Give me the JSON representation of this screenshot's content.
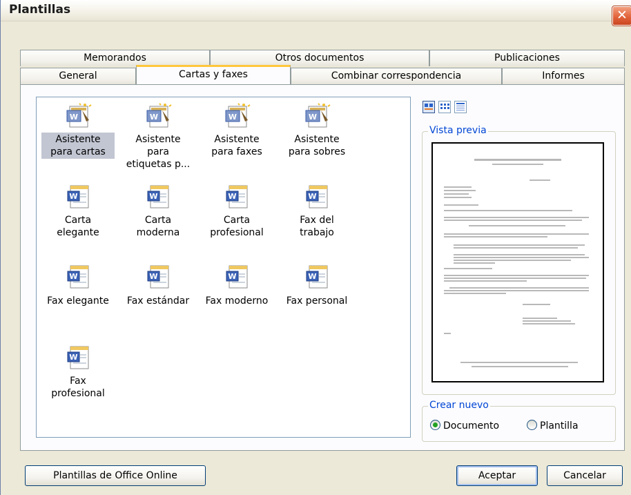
{
  "window": {
    "title": "Plantillas"
  },
  "tabs": {
    "row_back": [
      {
        "label": "Memorandos"
      },
      {
        "label": "Otros documentos"
      },
      {
        "label": "Publicaciones"
      }
    ],
    "row_front": [
      {
        "label": "General"
      },
      {
        "label": "Cartas y faxes",
        "active": true
      },
      {
        "label": "Combinar correspondencia"
      },
      {
        "label": "Informes"
      }
    ]
  },
  "templates": [
    {
      "label": "Asistente para cartas",
      "icon": "wizard-icon",
      "selected": true
    },
    {
      "label": "Asistente para etiquetas p...",
      "icon": "wizard-icon"
    },
    {
      "label": "Asistente para faxes",
      "icon": "wizard-icon"
    },
    {
      "label": "Asistente para sobres",
      "icon": "wizard-icon"
    },
    {
      "label": "Carta elegante",
      "icon": "word-template-icon"
    },
    {
      "label": "Carta moderna",
      "icon": "word-template-icon"
    },
    {
      "label": "Carta profesional",
      "icon": "word-template-icon"
    },
    {
      "label": "Fax del trabajo",
      "icon": "word-template-icon"
    },
    {
      "label": "Fax elegante",
      "icon": "word-template-icon"
    },
    {
      "label": "Fax estándar",
      "icon": "word-template-icon"
    },
    {
      "label": "Fax moderno",
      "icon": "word-template-icon"
    },
    {
      "label": "Fax personal",
      "icon": "word-template-icon"
    },
    {
      "label": "Fax profesional",
      "icon": "word-template-icon"
    }
  ],
  "view_modes": [
    {
      "icon": "large-icons-view-icon",
      "active": true
    },
    {
      "icon": "list-view-icon"
    },
    {
      "icon": "details-view-icon"
    }
  ],
  "preview": {
    "legend": "Vista previa"
  },
  "create_new": {
    "legend": "Crear nuevo",
    "options": [
      {
        "label": "Documento",
        "checked": true
      },
      {
        "label": "Plantilla",
        "checked": false
      }
    ]
  },
  "buttons": {
    "online": "Plantillas de Office Online",
    "ok": "Aceptar",
    "cancel": "Cancelar"
  },
  "colors": {
    "accent_tab": "#ffc73c",
    "selection": "#c2c6d2",
    "legend_text": "#0046d5",
    "close": "#e2643c"
  }
}
